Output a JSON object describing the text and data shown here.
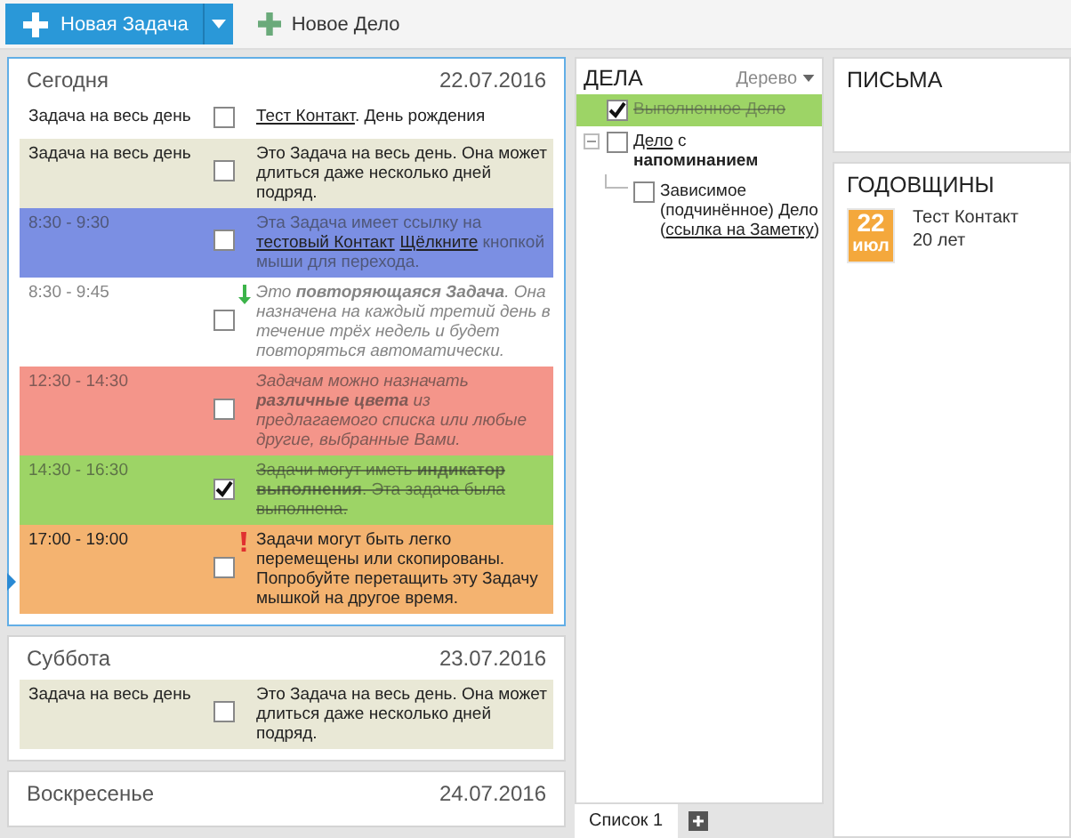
{
  "toolbar": {
    "new_task": "Новая Задача",
    "new_item": "Новое Дело"
  },
  "days": [
    {
      "title": "Сегодня",
      "date": "22.07.2016",
      "current": true,
      "tasks": [
        {
          "kind": "plain",
          "time": "Задача на весь день",
          "color": "#ffffff",
          "checked": false,
          "faded": false,
          "italic": false,
          "segments": [
            {
              "text": "Тест Контакт",
              "link": true
            },
            {
              "text": ". День рождения",
              "link": false
            }
          ]
        },
        {
          "kind": "plain",
          "time": "Задача на весь день",
          "color": "#e9e8d6",
          "checked": false,
          "faded": false,
          "italic": false,
          "segments": [
            {
              "text": "Это Задача на весь день. Она может длиться даже несколько дней подряд.",
              "link": false
            }
          ]
        },
        {
          "kind": "plain",
          "time": "8:30 - 9:30",
          "color": "#7b8fe3",
          "checked": false,
          "faded": true,
          "italic": false,
          "segments": [
            {
              "text": "Эта Задача имеет ссылку на ",
              "link": false
            },
            {
              "text": "тестовый Контакт",
              "link": true
            },
            {
              "text": "Щёлкните",
              "link": true
            },
            {
              "text": " кнопкой мыши для перехода.",
              "link": false
            }
          ]
        },
        {
          "kind": "recurring",
          "time": "8:30 - 9:45",
          "color": "#ffffff",
          "checked": false,
          "faded": true,
          "italic": true,
          "segments": [
            {
              "text": "Это **повторяющаяся Задача**. Она назначена на каждый третий день в течение трёх недель и будет повторяться автоматически.",
              "link": false
            }
          ]
        },
        {
          "kind": "plain",
          "time": "12:30 - 14:30",
          "color": "#f4958a",
          "checked": false,
          "faded": true,
          "italic": true,
          "segments": [
            {
              "text": "Задачам можно назначать **различные цвета** из предлагаемого списка или любые другие, выбранные Вами.",
              "link": false
            }
          ]
        },
        {
          "kind": "plain",
          "time": "14:30 - 16:30",
          "color": "#9dd466",
          "checked": true,
          "faded": true,
          "italic": false,
          "segments": [
            {
              "text": "Задачи могут иметь **индикатор выполнения**. Эта задача была выполнена.",
              "link": false
            }
          ]
        },
        {
          "kind": "priority",
          "time": "17:00 - 19:00",
          "color": "#f4b370",
          "checked": false,
          "faded": false,
          "italic": false,
          "segments": [
            {
              "text": "Задачи могут быть легко перемещены или скопированы. Попробуйте перетащить эту Задачу мышкой на другое время.",
              "link": false
            }
          ]
        }
      ]
    },
    {
      "title": "Суббота",
      "date": "23.07.2016",
      "current": false,
      "tasks": [
        {
          "kind": "plain",
          "time": "Задача на весь день",
          "color": "#e9e8d6",
          "checked": false,
          "faded": false,
          "italic": false,
          "segments": [
            {
              "text": "Это Задача на весь день. Она может длиться даже несколько дней подряд.",
              "link": false
            }
          ]
        }
      ]
    },
    {
      "title": "Воскресенье",
      "date": "24.07.2016",
      "current": false
    }
  ],
  "todo": {
    "title": "ДЕЛА",
    "view": "Дерево",
    "items": [
      {
        "checked": true,
        "segments": [
          {
            "text": "Выполненное Дело",
            "link": false
          }
        ]
      },
      {
        "checked": false,
        "expanded": true,
        "segments": [
          {
            "text": "Дело",
            "link": true
          },
          {
            "text": " с **напоминанием**",
            "link": false
          }
        ],
        "children": [
          {
            "checked": false,
            "segments": [
              {
                "text": "Зависимое (подчинённое) Дело (",
                "link": false
              },
              {
                "text": "ссылка на Заметку",
                "link": true
              },
              {
                "text": ")",
                "link": false
              }
            ]
          }
        ]
      }
    ],
    "tabs": [
      {
        "label": "Список 1",
        "selected": true
      }
    ]
  },
  "letters": {
    "title": "ПИСЬМА"
  },
  "anniversaries": {
    "title": "ГОДОВЩИНЫ",
    "items": [
      {
        "day": "22",
        "month": "июл",
        "name": "Тест Контакт",
        "years": "20 лет"
      }
    ]
  }
}
